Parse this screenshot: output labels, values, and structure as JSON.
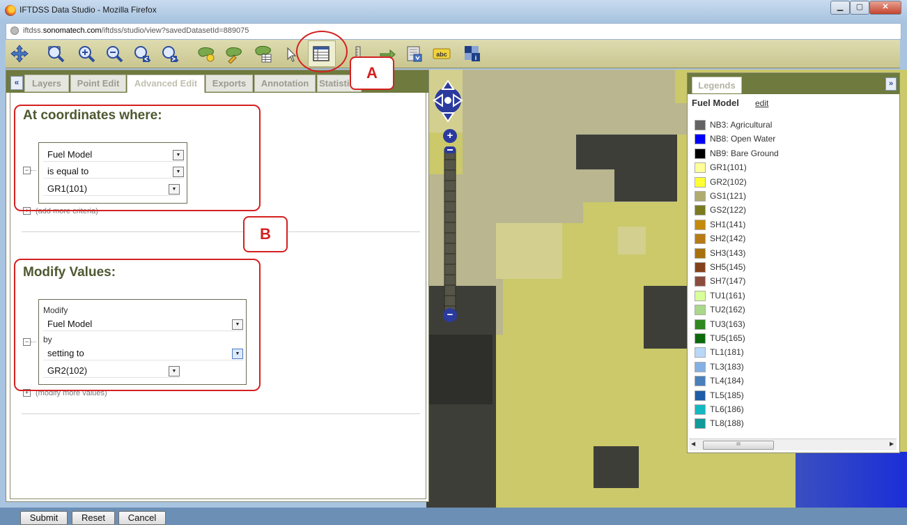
{
  "window": {
    "title": "IFTDSS Data Studio - Mozilla Firefox",
    "controls": {
      "minimize": "▁",
      "maximize": "▢",
      "close": "✕"
    }
  },
  "address_bar": {
    "prefix": "iftdss.",
    "domain": "sonomatech.com",
    "path": "/iftdss/studio/view?savedDatasetId=889075"
  },
  "toolbar": {
    "icons": [
      "pan-icon",
      "zoom-extent-icon",
      "zoom-in-icon",
      "zoom-out-icon",
      "zoom-previous-icon",
      "zoom-next-icon",
      "add-layer-icon",
      "edit-layer-icon",
      "layer-attributes-icon",
      "select-arrow-icon",
      "attribute-table-icon",
      "measure-icon",
      "forward-icon",
      "export-map-icon",
      "label-abc-icon",
      "identify-icon"
    ]
  },
  "annotations": {
    "a": "A",
    "b": "B"
  },
  "left_panel": {
    "collapse": "«",
    "tabs": [
      "Layers",
      "Point Edit",
      "Advanced Edit",
      "Exports",
      "Annotation",
      "Statistics"
    ],
    "active_tab": "Advanced Edit",
    "coordinates": {
      "title": "At coordinates where:",
      "field": "Fuel Model",
      "operator": "is equal to",
      "value": "GR1(101)",
      "add_more": "(add more criteria)"
    },
    "modify": {
      "title": "Modify Values:",
      "modify_label": "Modify",
      "field": "Fuel Model",
      "by_label": "by",
      "method": "setting to",
      "value": "GR2(102)",
      "add_more": "(modify more values)"
    },
    "buttons": {
      "submit": "Submit",
      "reset": "Reset",
      "cancel": "Cancel"
    }
  },
  "legend": {
    "tab": "Legends",
    "expand": "»",
    "title": "Fuel Model",
    "edit": "edit",
    "scroll_thumb": "III",
    "items": [
      {
        "label": "NB3: Agricultural",
        "color": "#636363"
      },
      {
        "label": "NB8: Open Water",
        "color": "#0000ff"
      },
      {
        "label": "NB9: Bare Ground",
        "color": "#000000"
      },
      {
        "label": "GR1(101)",
        "color": "#ffff99"
      },
      {
        "label": "GR2(102)",
        "color": "#ffff33"
      },
      {
        "label": "GS1(121)",
        "color": "#b0ac70"
      },
      {
        "label": "GS2(122)",
        "color": "#7a7a1e"
      },
      {
        "label": "SH1(141)",
        "color": "#c58a0c"
      },
      {
        "label": "SH2(142)",
        "color": "#b87a14"
      },
      {
        "label": "SH3(143)",
        "color": "#a8700c"
      },
      {
        "label": "SH5(145)",
        "color": "#84421c"
      },
      {
        "label": "SH7(147)",
        "color": "#8c4c3c"
      },
      {
        "label": "TU1(161)",
        "color": "#d8ff99"
      },
      {
        "label": "TU2(162)",
        "color": "#aad88a"
      },
      {
        "label": "TU3(163)",
        "color": "#2e8a1e"
      },
      {
        "label": "TU5(165)",
        "color": "#0a6a0a"
      },
      {
        "label": "TL1(181)",
        "color": "#b8d8f8"
      },
      {
        "label": "TL3(183)",
        "color": "#84b0e4"
      },
      {
        "label": "TL4(184)",
        "color": "#4a7fbc"
      },
      {
        "label": "TL5(185)",
        "color": "#1e5ca8"
      },
      {
        "label": "TL6(186)",
        "color": "#14b8c0"
      },
      {
        "label": "TL8(188)",
        "color": "#109a9a"
      }
    ]
  },
  "map": {
    "zoom_in": "+",
    "zoom_out": "−",
    "zoom_out_bottom": "−"
  }
}
